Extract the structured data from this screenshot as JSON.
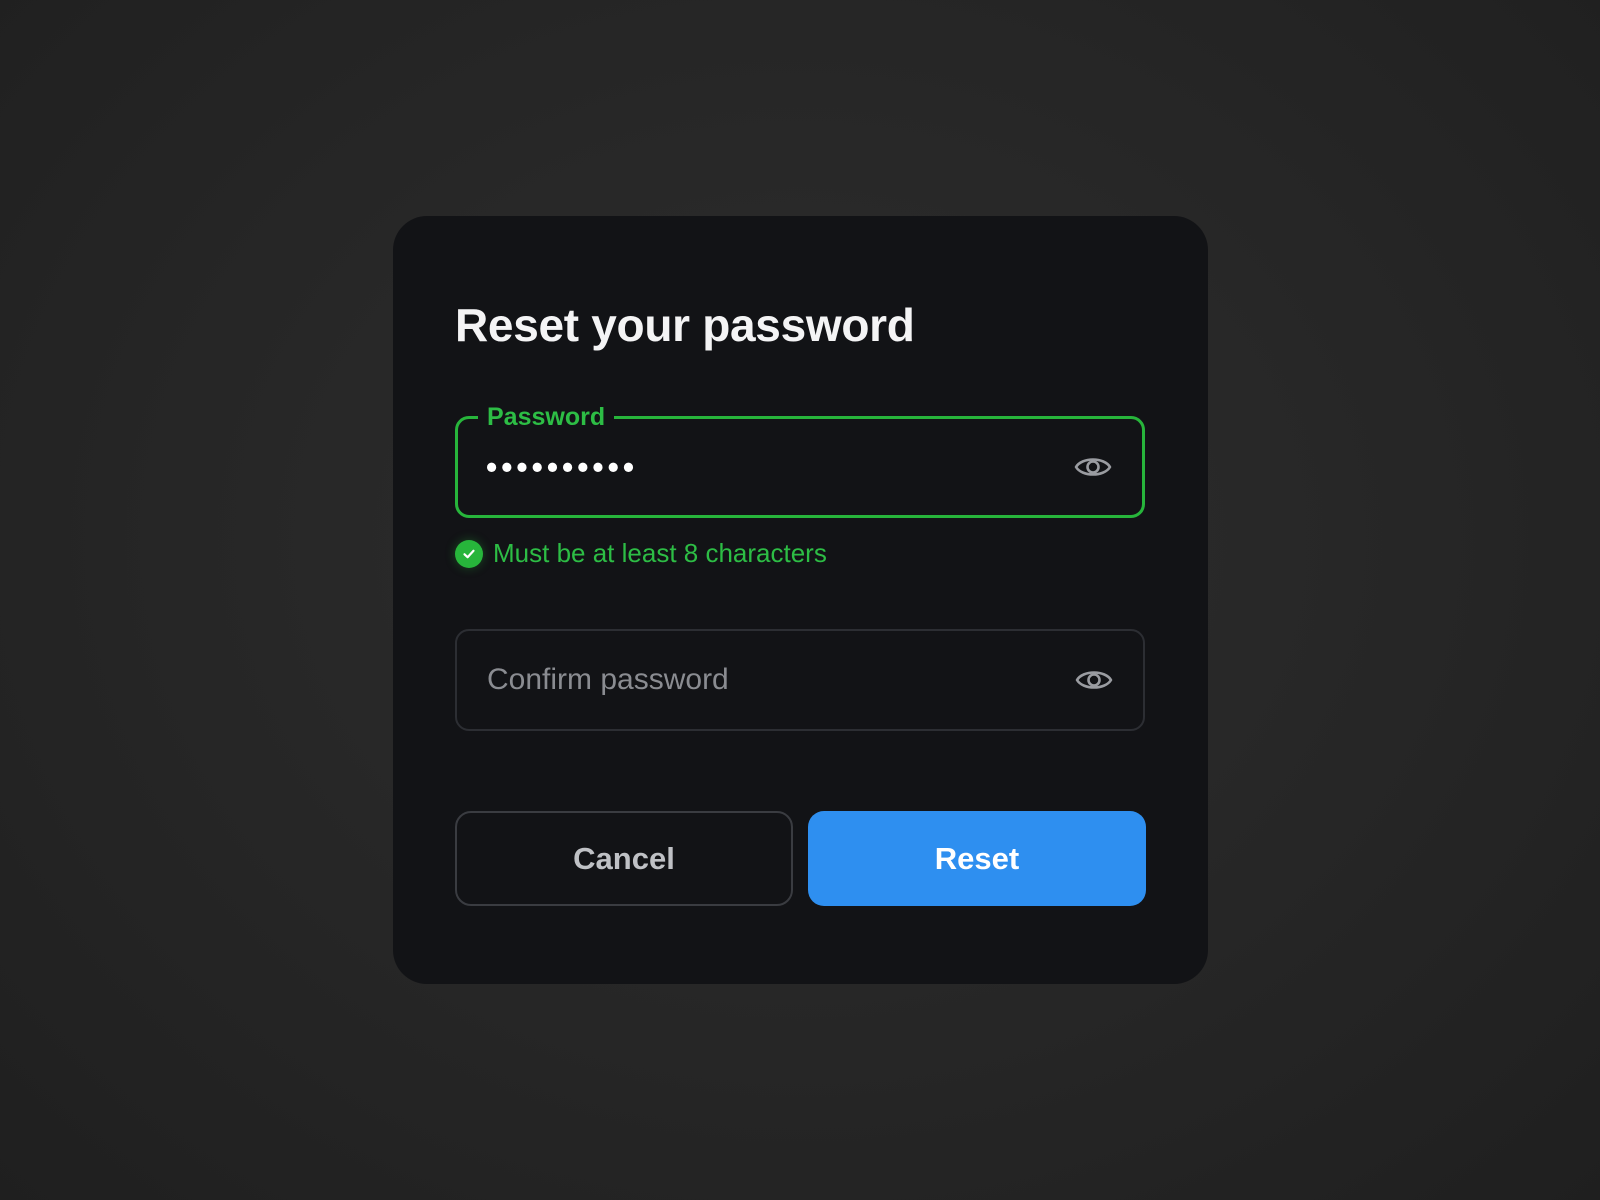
{
  "dialog": {
    "title": "Reset your password",
    "password": {
      "label": "Password",
      "masked_value": "••••••••••",
      "hint": "Must be at least 8 characters",
      "hint_color": "#27b53b",
      "toggle_icon": "eye-icon"
    },
    "confirm": {
      "value": "",
      "placeholder": "Confirm password",
      "toggle_icon": "eye-icon"
    },
    "buttons": {
      "cancel_label": "Cancel",
      "reset_label": "Reset",
      "reset_color": "#2e8ff0"
    }
  }
}
